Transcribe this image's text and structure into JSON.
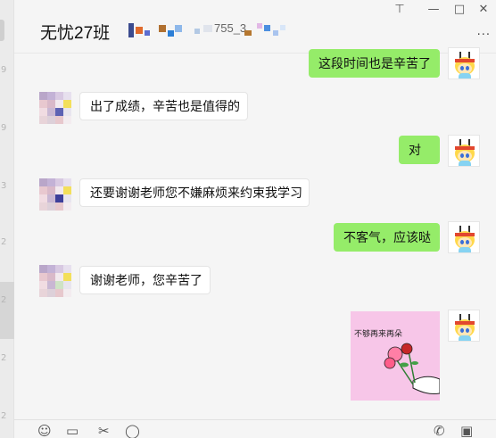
{
  "left_list": {
    "ticks": [
      "9",
      "9",
      "3",
      "2",
      "2",
      "2",
      "2"
    ]
  },
  "header": {
    "title": "无忧27班",
    "title_mosaic_tail": "755_3",
    "pin_icon": "pin-icon",
    "minimize_icon": "minimize-icon",
    "maximize_icon": "maximize-icon",
    "close_icon": "close-icon",
    "more_icon": "more-icon"
  },
  "messages": [
    {
      "side": "right",
      "text": "这段时间也是辛苦了"
    },
    {
      "side": "left",
      "text": "出了成绩，辛苦也是值得的"
    },
    {
      "side": "right",
      "text": "对"
    },
    {
      "side": "left",
      "text": "还要谢谢老师您不嫌麻烦来约束我学习"
    },
    {
      "side": "right",
      "text": "不客气，应该哒"
    },
    {
      "side": "left",
      "text": "谢谢老师，您辛苦了"
    },
    {
      "side": "right",
      "type": "sticker",
      "text": "不够再来再朵"
    }
  ],
  "toolbar": {
    "icons": [
      "emoji-icon",
      "folder-icon",
      "scissors-icon",
      "chat-icon",
      "phone-icon",
      "video-icon"
    ]
  },
  "colors": {
    "self_bubble": "#95ec69",
    "other_bubble": "#ffffff",
    "background": "#f5f5f5"
  }
}
